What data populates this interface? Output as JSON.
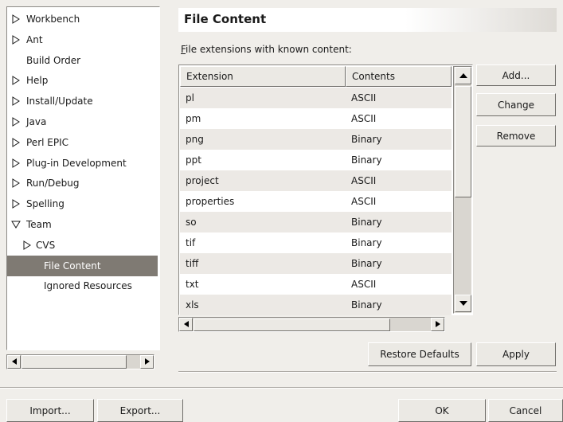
{
  "preferences_tree": {
    "items": [
      {
        "label": "Workbench",
        "expander": "collapsed",
        "level": 0,
        "selected": false
      },
      {
        "label": "Ant",
        "expander": "collapsed",
        "level": 0,
        "selected": false
      },
      {
        "label": "Build Order",
        "expander": "none",
        "level": 0,
        "selected": false
      },
      {
        "label": "Help",
        "expander": "collapsed",
        "level": 0,
        "selected": false
      },
      {
        "label": "Install/Update",
        "expander": "collapsed",
        "level": 0,
        "selected": false
      },
      {
        "label": "Java",
        "expander": "collapsed",
        "level": 0,
        "selected": false
      },
      {
        "label": "Perl EPIC",
        "expander": "collapsed",
        "level": 0,
        "selected": false
      },
      {
        "label": "Plug-in Development",
        "expander": "collapsed",
        "level": 0,
        "selected": false
      },
      {
        "label": "Run/Debug",
        "expander": "collapsed",
        "level": 0,
        "selected": false
      },
      {
        "label": "Spelling",
        "expander": "collapsed",
        "level": 0,
        "selected": false
      },
      {
        "label": "Team",
        "expander": "expanded",
        "level": 0,
        "selected": false
      },
      {
        "label": "CVS",
        "expander": "collapsed",
        "level": 1,
        "selected": false
      },
      {
        "label": "File Content",
        "expander": "none",
        "level": 2,
        "selected": true
      },
      {
        "label": "Ignored Resources",
        "expander": "none",
        "level": 2,
        "selected": false
      }
    ]
  },
  "page": {
    "title": "File Content",
    "list_caption": "File extensions with known content:",
    "list_caption_mnemonic": "F",
    "list_caption_rest": "ile extensions with known content:"
  },
  "table": {
    "columns": [
      "Extension",
      "Contents"
    ],
    "rows": [
      [
        "pl",
        "ASCII"
      ],
      [
        "pm",
        "ASCII"
      ],
      [
        "png",
        "Binary"
      ],
      [
        "ppt",
        "Binary"
      ],
      [
        "project",
        "ASCII"
      ],
      [
        "properties",
        "ASCII"
      ],
      [
        "so",
        "Binary"
      ],
      [
        "tif",
        "Binary"
      ],
      [
        "tiff",
        "Binary"
      ],
      [
        "txt",
        "ASCII"
      ],
      [
        "xls",
        "Binary"
      ]
    ]
  },
  "buttons": {
    "add": "Add...",
    "change": "Change",
    "remove": "Remove",
    "restore_defaults": "Restore Defaults",
    "apply": "Apply",
    "import": "Import...",
    "export": "Export...",
    "ok": "OK",
    "cancel": "Cancel"
  },
  "icons": {
    "collapsed": "triangle-right-icon",
    "expanded": "triangle-down-icon",
    "scroll_up": "arrow-up-icon",
    "scroll_down": "arrow-down-icon",
    "scroll_left": "arrow-left-icon",
    "scroll_right": "arrow-right-icon"
  },
  "colors": {
    "selection": "#7f7a73",
    "window_bg": "#f0eeea"
  }
}
